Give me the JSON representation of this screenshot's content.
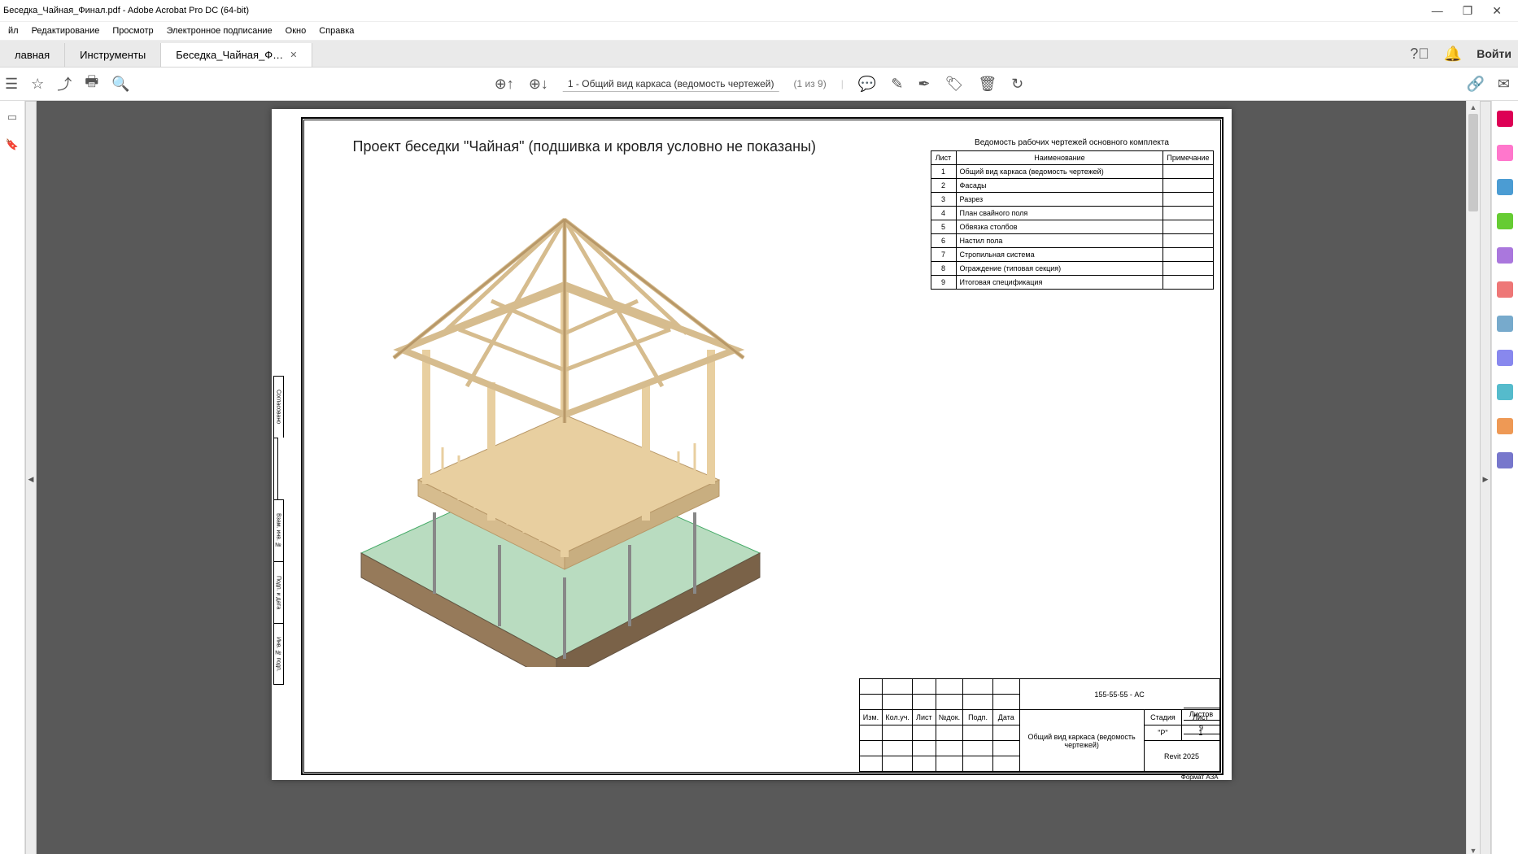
{
  "window": {
    "title": "Беседка_Чайная_Финал.pdf - Adobe Acrobat Pro DC (64-bit)"
  },
  "menu": {
    "file": "йл",
    "edit": "Редактирование",
    "view": "Просмотр",
    "esign": "Электронное подписание",
    "window": "Окно",
    "help": "Справка"
  },
  "tabs": {
    "home": "лавная",
    "tools": "Инструменты",
    "doc": "Беседка_Чайная_Ф…"
  },
  "header_right": {
    "login": "Войти"
  },
  "toolbar": {
    "page_label": "1 - Общий вид каркаса (ведомость чертежей)",
    "page_count": "(1 из 9)"
  },
  "drawing": {
    "title": "Проект беседки \"Чайная\" (подшивка и кровля условно не показаны)"
  },
  "schedule": {
    "title": "Ведомость рабочих чертежей основного комплекта",
    "col1": "Лист",
    "col2": "Наименование",
    "col3": "Примечание",
    "rows": [
      {
        "n": "1",
        "name": "Общий вид каркаса (ведомость чертежей)",
        "note": ""
      },
      {
        "n": "2",
        "name": "Фасады",
        "note": ""
      },
      {
        "n": "3",
        "name": "Разрез",
        "note": ""
      },
      {
        "n": "4",
        "name": "План свайного поля",
        "note": ""
      },
      {
        "n": "5",
        "name": "Обвязка столбов",
        "note": ""
      },
      {
        "n": "6",
        "name": "Настил пола",
        "note": ""
      },
      {
        "n": "7",
        "name": "Стропильная система",
        "note": ""
      },
      {
        "n": "8",
        "name": "Ограждение (типовая секция)",
        "note": ""
      },
      {
        "n": "9",
        "name": "Итоговая спецификация",
        "note": ""
      }
    ]
  },
  "sideblock": {
    "r1": "Согласовано",
    "r2": "",
    "r3": "Взам. инв. №",
    "r4": "Подп. и дата",
    "r5": "Инв. № подп."
  },
  "titleblock": {
    "proj_num": "155-55-55 - АС",
    "h_izm": "Изм.",
    "h_kol": "Кол.уч.",
    "h_list": "Лист",
    "h_ndoc": "№док.",
    "h_podp": "Подп.",
    "h_date": "Дата",
    "sheet_title": "Общий вид каркаса (ведомость чертежей)",
    "h_stage": "Стадия",
    "h_sheet": "Лист",
    "h_sheets": "Листов",
    "v_stage": "\"Р\"",
    "v_sheet": "1",
    "v_sheets": "9",
    "software": "Revit 2025",
    "format": "Формат А3А"
  }
}
